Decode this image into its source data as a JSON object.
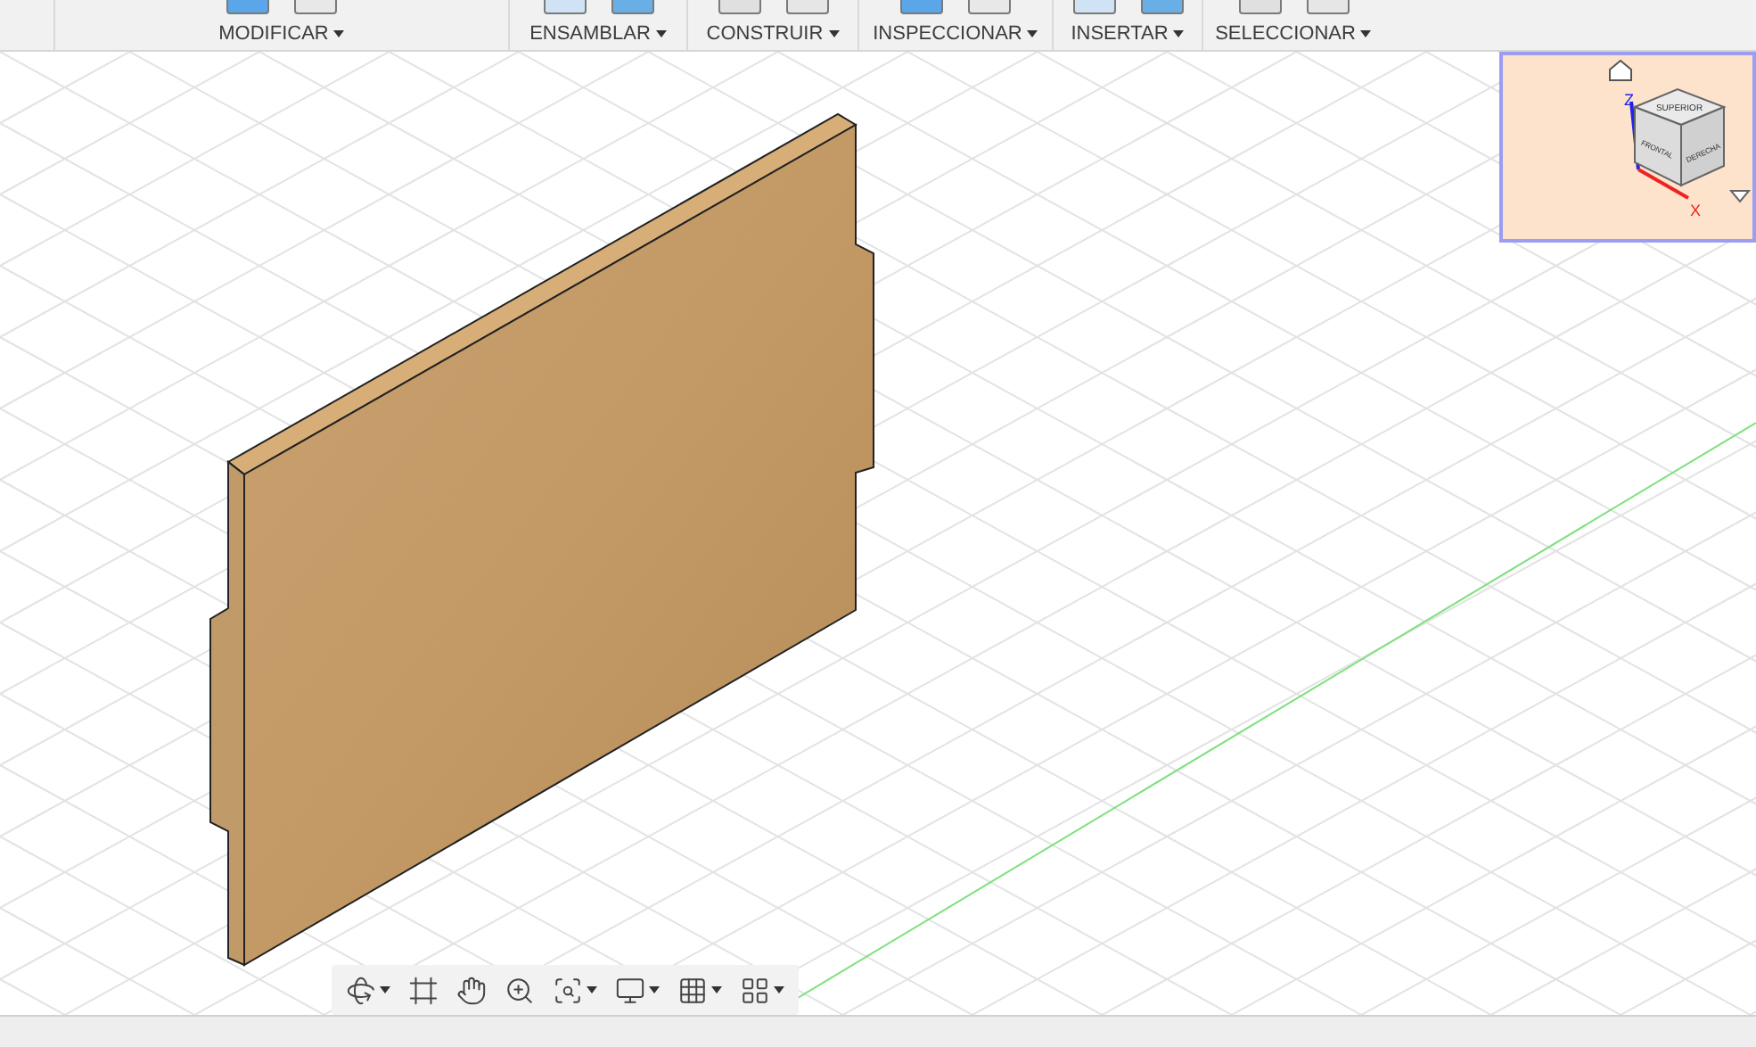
{
  "toolbar": {
    "groups": [
      {
        "label": "MODIFICAR"
      },
      {
        "label": "ENSAMBLAR"
      },
      {
        "label": "CONSTRUIR"
      },
      {
        "label": "INSPECCIONAR"
      },
      {
        "label": "INSERTAR"
      },
      {
        "label": "SELECCIONAR"
      }
    ]
  },
  "viewcube": {
    "faces": [
      {
        "kind": "top",
        "label": "SUPERIOR"
      },
      {
        "kind": "front",
        "label": "FRONTAL"
      },
      {
        "kind": "right",
        "label": "DERECHA"
      }
    ],
    "axes": [
      {
        "kind": "z",
        "label": "Z"
      },
      {
        "kind": "x",
        "label": "X"
      }
    ]
  },
  "nav_bar": {
    "tools": [
      {
        "kind": "orbit",
        "has_menu": true
      },
      {
        "kind": "look",
        "has_menu": false
      },
      {
        "kind": "pan",
        "has_menu": false
      },
      {
        "kind": "zoom",
        "has_menu": false
      },
      {
        "kind": "fit",
        "has_menu": true
      },
      {
        "kind": "display",
        "has_menu": true
      },
      {
        "kind": "grid",
        "has_menu": true
      },
      {
        "kind": "viewports",
        "has_menu": true
      }
    ]
  }
}
